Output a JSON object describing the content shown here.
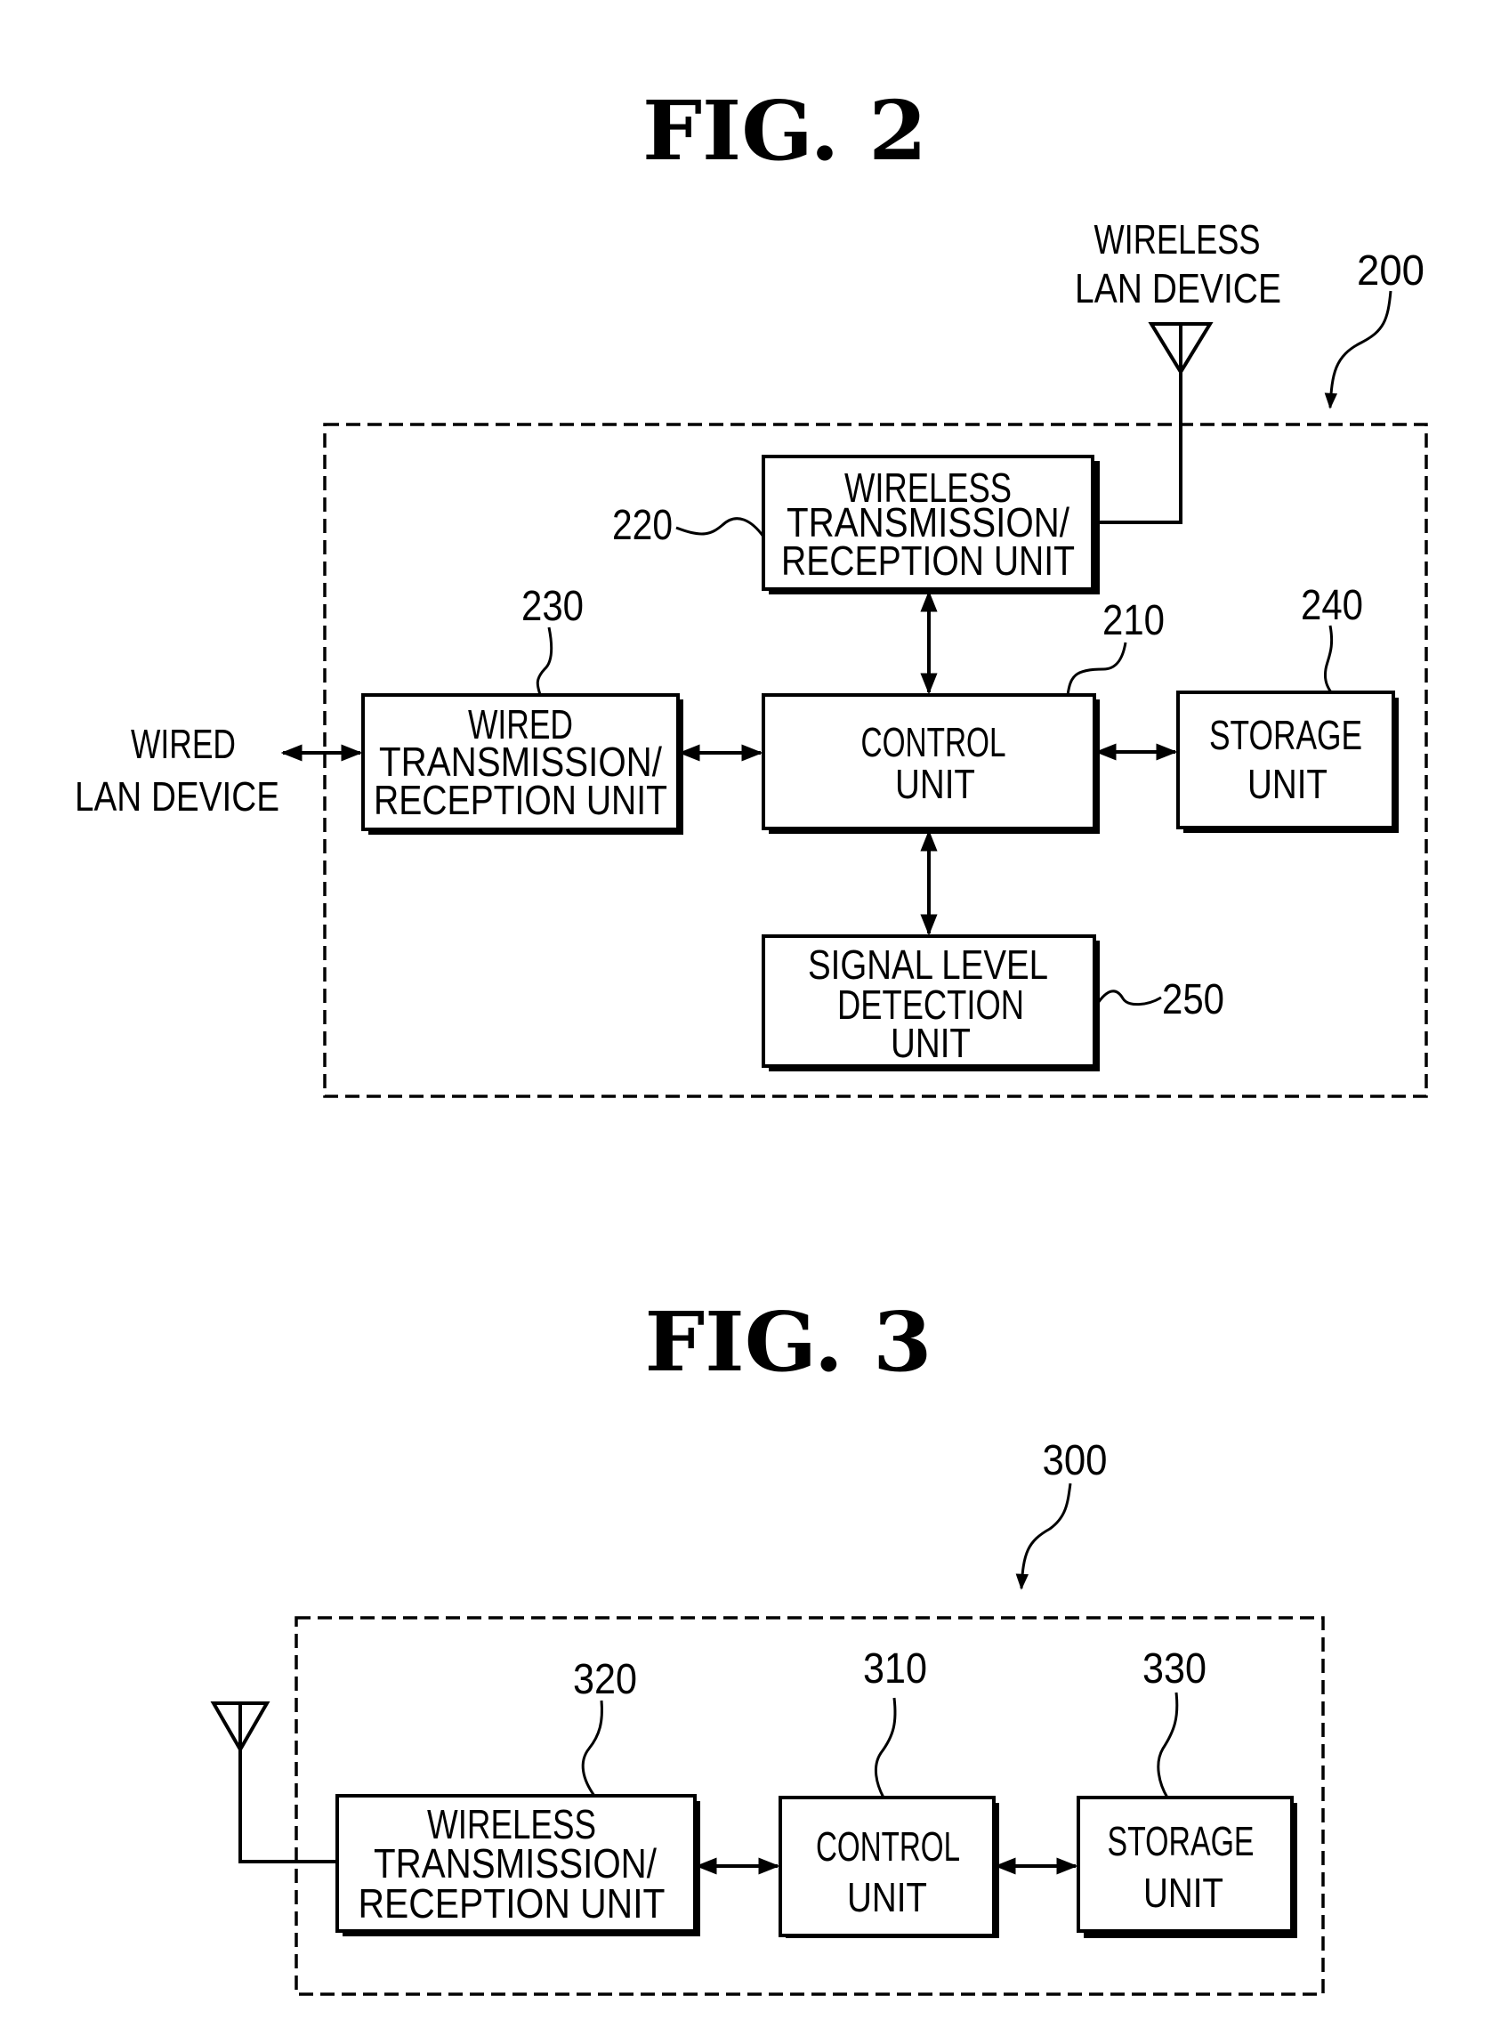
{
  "figures": [
    {
      "title": "FIG. 2",
      "reference": "200",
      "external": {
        "wireless_lan_device": [
          "WIRELESS",
          "LAN DEVICE"
        ],
        "wired_lan_device": [
          "WIRED",
          "LAN DEVICE"
        ]
      },
      "blocks": [
        {
          "id": "220",
          "lines": [
            "WIRELESS",
            "TRANSMISSION/",
            "RECEPTION UNIT"
          ]
        },
        {
          "id": "230",
          "lines": [
            "WIRED",
            "TRANSMISSION/",
            "RECEPTION UNIT"
          ]
        },
        {
          "id": "210",
          "lines": [
            "CONTROL",
            "UNIT"
          ]
        },
        {
          "id": "240",
          "lines": [
            "STORAGE",
            "UNIT"
          ]
        },
        {
          "id": "250",
          "lines": [
            "SIGNAL LEVEL",
            "DETECTION",
            "UNIT"
          ]
        }
      ]
    },
    {
      "title": "FIG. 3",
      "reference": "300",
      "blocks": [
        {
          "id": "320",
          "lines": [
            "WIRELESS",
            "TRANSMISSION/",
            "RECEPTION UNIT"
          ]
        },
        {
          "id": "310",
          "lines": [
            "CONTROL",
            "UNIT"
          ]
        },
        {
          "id": "330",
          "lines": [
            "STORAGE",
            "UNIT"
          ]
        }
      ]
    }
  ]
}
